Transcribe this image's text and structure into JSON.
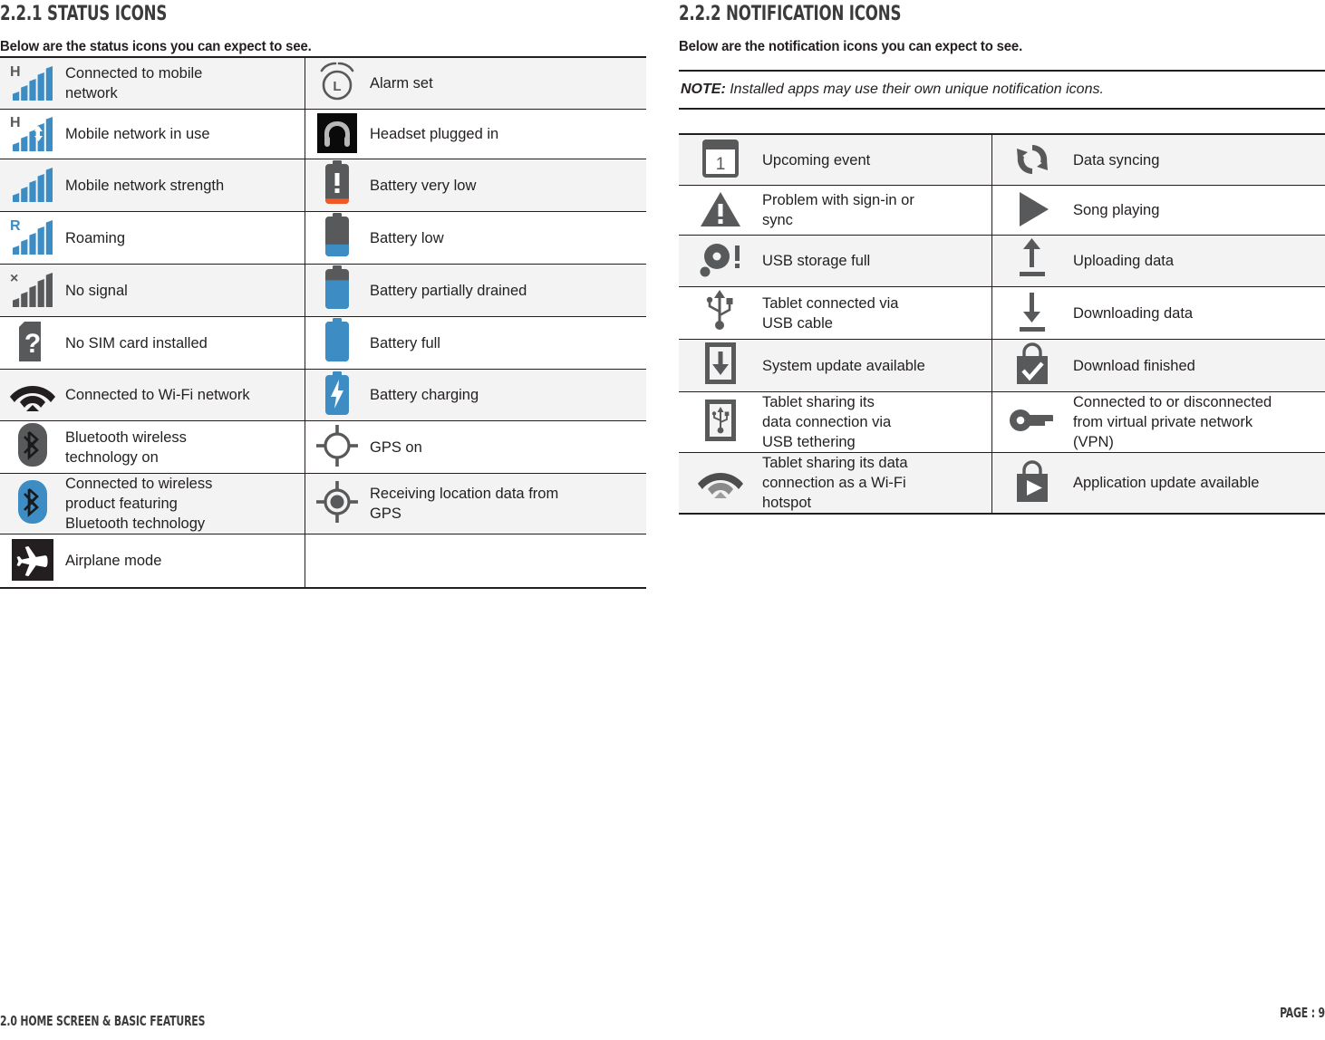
{
  "colors": {
    "accent_blue": "#3d8dc4",
    "dark_gray": "#58595b",
    "orange": "#f15a24",
    "black": "#231f20",
    "row_shade": "#f3f3f3"
  },
  "left": {
    "heading": "2.2.1 STATUS ICONS",
    "subheading": "Below are the status icons you can expect to see.",
    "rows": [
      {
        "left_icon": "signal-h-icon",
        "left_label": "Connected to mobile network",
        "right_icon": "alarm-clock-icon",
        "right_label": "Alarm set"
      },
      {
        "left_icon": "signal-h-inuse-icon",
        "left_label": "Mobile network in use",
        "right_icon": "headset-icon",
        "right_label": "Headset plugged in"
      },
      {
        "left_icon": "signal-strength-icon",
        "left_label": "Mobile network strength",
        "right_icon": "battery-very-low-icon",
        "right_label": "Battery very low"
      },
      {
        "left_icon": "signal-roaming-icon",
        "left_label": "Roaming",
        "right_icon": "battery-low-icon",
        "right_label": "Battery low"
      },
      {
        "left_icon": "signal-none-icon",
        "left_label": "No signal",
        "right_icon": "battery-partial-icon",
        "right_label": "Battery partially drained"
      },
      {
        "left_icon": "no-sim-card-icon",
        "left_label": "No SIM card installed",
        "right_icon": "battery-full-icon",
        "right_label": "Battery full"
      },
      {
        "left_icon": "wifi-icon",
        "left_label": "Connected to Wi-Fi network",
        "right_icon": "battery-charging-icon",
        "right_label": "Battery charging"
      },
      {
        "left_icon": "bluetooth-on-icon",
        "left_label": "Bluetooth wireless technology on",
        "right_icon": "gps-on-icon",
        "right_label": "GPS on"
      },
      {
        "left_icon": "bluetooth-connected-icon",
        "left_label": "Connected to wireless product featuring Bluetooth technology",
        "right_icon": "gps-fix-icon",
        "right_label": "Receiving location data from GPS"
      },
      {
        "left_icon": "airplane-mode-icon",
        "left_label": "Airplane mode",
        "right_icon": "",
        "right_label": ""
      }
    ],
    "label_lines": [
      [
        "Connected to mobile",
        "network"
      ],
      [
        "Mobile network in use"
      ],
      [
        "Mobile network strength"
      ],
      [
        "Roaming"
      ],
      [
        "No signal"
      ],
      [
        "No SIM card installed"
      ],
      [
        "Connected to Wi-Fi network"
      ],
      [
        "Bluetooth wireless",
        "technology on"
      ],
      [
        "Connected to wireless",
        "product featuring",
        "Bluetooth technology"
      ],
      [
        "Airplane mode"
      ]
    ],
    "right_label_lines": [
      [
        "Alarm set"
      ],
      [
        "Headset plugged in"
      ],
      [
        "Battery very low"
      ],
      [
        "Battery low"
      ],
      [
        "Battery partially drained"
      ],
      [
        "Battery full"
      ],
      [
        "Battery charging"
      ],
      [
        "GPS on"
      ],
      [
        "Receiving location data from",
        "GPS"
      ],
      [
        ""
      ]
    ],
    "signal_tags": [
      "H",
      "H",
      "",
      "R",
      "×"
    ]
  },
  "right": {
    "heading": "2.2.2 NOTIFICATION ICONS",
    "subheading": "Below are the notification icons you can expect to see.",
    "note_label": "NOTE:",
    "note_text": " Installed apps may use their own unique notification icons.",
    "rows": [
      {
        "left_icon": "calendar-event-icon",
        "left_label": "Upcoming event",
        "right_icon": "data-sync-icon",
        "right_label": "Data syncing"
      },
      {
        "left_icon": "warning-triangle-icon",
        "left_label": "Problem with sign-in or sync",
        "right_icon": "play-song-icon",
        "right_label": "Song playing"
      },
      {
        "left_icon": "usb-storage-full-icon",
        "left_label": "USB storage full",
        "right_icon": "upload-arrow-icon",
        "right_label": "Uploading data"
      },
      {
        "left_icon": "usb-cable-icon",
        "left_label": "Tablet connected via USB cable",
        "right_icon": "download-arrow-icon",
        "right_label": "Downloading data"
      },
      {
        "left_icon": "system-update-icon",
        "left_label": "System update available",
        "right_icon": "download-finished-icon",
        "right_label": "Download finished"
      },
      {
        "left_icon": "usb-tethering-icon",
        "left_label": "Tablet sharing its data connection via USB tethering",
        "right_icon": "vpn-key-icon",
        "right_label": "Connected to or disconnected from virtual private network (VPN)"
      },
      {
        "left_icon": "wifi-hotspot-icon",
        "left_label": "Tablet sharing its data connection as a Wi-Fi hotspot",
        "right_icon": "app-update-icon",
        "right_label": "Application update available"
      }
    ],
    "label_lines": [
      [
        "Upcoming event"
      ],
      [
        "Problem with sign-in or",
        "sync"
      ],
      [
        "USB storage full"
      ],
      [
        "Tablet connected via",
        "USB cable"
      ],
      [
        "System update available"
      ],
      [
        "Tablet sharing its",
        "data connection via",
        "USB tethering"
      ],
      [
        "Tablet sharing its data",
        "connection as a Wi-Fi",
        "hotspot"
      ]
    ],
    "right_label_lines": [
      [
        "Data syncing"
      ],
      [
        "Song playing"
      ],
      [
        "Uploading data"
      ],
      [
        "Downloading data"
      ],
      [
        "Download finished"
      ],
      [
        "Connected to or disconnected",
        "from virtual private network",
        "(VPN)"
      ],
      [
        "Application update available"
      ]
    ]
  },
  "footer": {
    "left": "2.0 HOME SCREEN & BASIC FEATURES",
    "right": "PAGE : 9"
  }
}
